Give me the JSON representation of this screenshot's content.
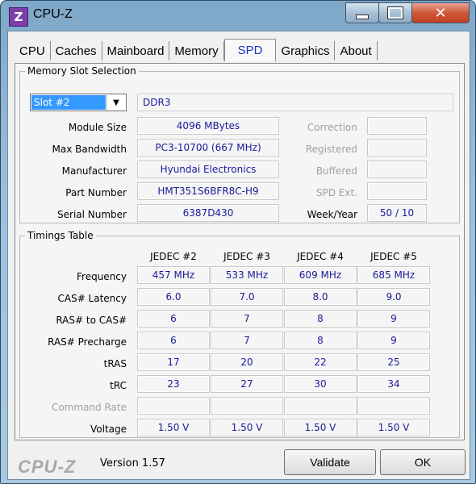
{
  "window": {
    "title": "CPU-Z",
    "icon_letter": "Z",
    "close_glyph": "✕"
  },
  "tabs": [
    {
      "label": "CPU"
    },
    {
      "label": "Caches"
    },
    {
      "label": "Mainboard"
    },
    {
      "label": "Memory"
    },
    {
      "label": "SPD",
      "active": true
    },
    {
      "label": "Graphics"
    },
    {
      "label": "About"
    }
  ],
  "slot_section": {
    "legend": "Memory Slot Selection",
    "selected_slot": "Slot #2",
    "memory_type": "DDR3",
    "fields": [
      {
        "label": "Module Size",
        "value": "4096 MBytes"
      },
      {
        "label": "Max Bandwidth",
        "value": "PC3-10700 (667 MHz)"
      },
      {
        "label": "Manufacturer",
        "value": "Hyundai Electronics"
      },
      {
        "label": "Part Number",
        "value": "HMT351S6BFR8C-H9"
      },
      {
        "label": "Serial Number",
        "value": "6387D430"
      }
    ],
    "right_fields": [
      {
        "label": "Correction",
        "value": ""
      },
      {
        "label": "Registered",
        "value": ""
      },
      {
        "label": "Buffered",
        "value": ""
      },
      {
        "label": "SPD Ext.",
        "value": ""
      },
      {
        "label": "Week/Year",
        "value": "50 / 10"
      }
    ]
  },
  "timings": {
    "legend": "Timings Table",
    "columns": [
      "JEDEC #2",
      "JEDEC #3",
      "JEDEC #4",
      "JEDEC #5"
    ],
    "rows": [
      {
        "label": "Frequency",
        "values": [
          "457 MHz",
          "533 MHz",
          "609 MHz",
          "685 MHz"
        ]
      },
      {
        "label": "CAS# Latency",
        "values": [
          "6.0",
          "7.0",
          "8.0",
          "9.0"
        ]
      },
      {
        "label": "RAS# to CAS#",
        "values": [
          "6",
          "7",
          "8",
          "9"
        ]
      },
      {
        "label": "RAS# Precharge",
        "values": [
          "6",
          "7",
          "8",
          "9"
        ]
      },
      {
        "label": "tRAS",
        "values": [
          "17",
          "20",
          "22",
          "25"
        ]
      },
      {
        "label": "tRC",
        "values": [
          "23",
          "27",
          "30",
          "34"
        ]
      },
      {
        "label": "Command Rate",
        "values": [
          "",
          "",
          "",
          ""
        ]
      },
      {
        "label": "Voltage",
        "values": [
          "1.50 V",
          "1.50 V",
          "1.50 V",
          "1.50 V"
        ]
      }
    ]
  },
  "footer": {
    "logo": "CPU-Z",
    "version": "Version 1.57",
    "validate_label": "Validate",
    "ok_label": "OK"
  }
}
